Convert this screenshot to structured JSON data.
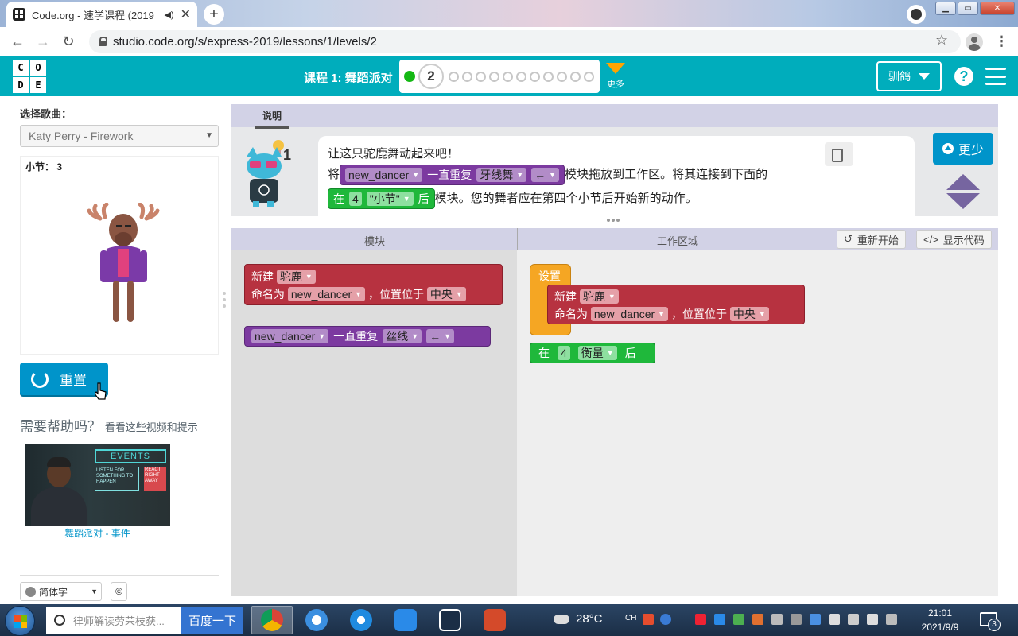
{
  "browser": {
    "tab_title": "Code.org - 速学课程 (2019",
    "tab_close": "✕",
    "new_tab": "+",
    "url": "studio.code.org/s/express-2019/lessons/1/levels/2",
    "back": "←",
    "forward": "→",
    "reload": "↻",
    "bookmark": "☆",
    "menu": "⋮",
    "minimize": "▁",
    "maximize": "▭",
    "close": "✕"
  },
  "header": {
    "logo_letters": [
      "C",
      "O",
      "D",
      "E"
    ],
    "lesson_title": "课程 1: 舞蹈派对",
    "current_level": "2",
    "remaining_levels": 11,
    "more_label": "更多",
    "user_label": "驯鸽",
    "help_label": "?"
  },
  "left": {
    "song_label": "选择歌曲：",
    "song_selected": "Katy Perry - Firework",
    "measure_label": "小节：",
    "measure_value": "3",
    "reset_label": "重置",
    "help_title": "需要帮助吗？",
    "help_subtitle": "看看这些视频和提示",
    "video_caption": "舞蹈派对 - 事件",
    "video_sign_title": "EVENTS",
    "video_sign_left": "LISTEN FOR SOMETHING TO HAPPEN",
    "video_sign_right": "REACT RIGHT AWAY",
    "language": "简体字",
    "copyright": "©"
  },
  "instructions": {
    "tab_label": "说明",
    "hint_count": "1",
    "line1": "让这只驼鹿舞动起来吧！",
    "line2_prefix": "将",
    "line2_suffix": "模块拖放到工作区。将其连接到下面的",
    "line3_suffix": "模块。您的舞者应在第四个小节后开始新的动作。",
    "less_label": "更少",
    "inline_block1": {
      "sprite": "new_dancer",
      "text": "一直重复",
      "move": "牙线舞",
      "dir": "←"
    },
    "inline_block2": {
      "pre": "在",
      "num": "4",
      "unit": "\"小节\"",
      "post": "后"
    }
  },
  "workspace": {
    "toolbox_label": "模块",
    "workspace_label": "工作区域",
    "restart_label": "重新开始",
    "show_code_label": "显示代码",
    "toolbox_blocks": {
      "new_label": "新建",
      "new_animal": "驼鹿",
      "name_label": "命名为",
      "name_value": "new_dancer",
      "pos_label": "，位置位于",
      "pos_value": "中央",
      "repeat_sprite": "new_dancer",
      "repeat_text": "一直重复",
      "repeat_move": "丝线",
      "repeat_dir": "←"
    },
    "workspace_blocks": {
      "setup_label": "设置",
      "new_label": "新建",
      "new_animal": "驼鹿",
      "name_label": "命名为",
      "name_value": "new_dancer",
      "pos_label": "，位置位于",
      "pos_value": "中央",
      "after_pre": "在",
      "after_num": "4",
      "after_unit": "衡量",
      "after_post": "后"
    }
  },
  "taskbar": {
    "search_placeholder": "律师解读劳荣枝获...",
    "search_button": "百度一下",
    "temperature": "28°C",
    "ime": "CH",
    "time": "21:01",
    "date": "2021/9/9",
    "notification_count": "3"
  },
  "colors": {
    "header_teal": "#00adbc",
    "block_purple": "#7c3aa0",
    "block_green": "#1fb83b",
    "block_red": "#b73240",
    "block_orange": "#f5a623",
    "button_blue": "#0094ca"
  }
}
